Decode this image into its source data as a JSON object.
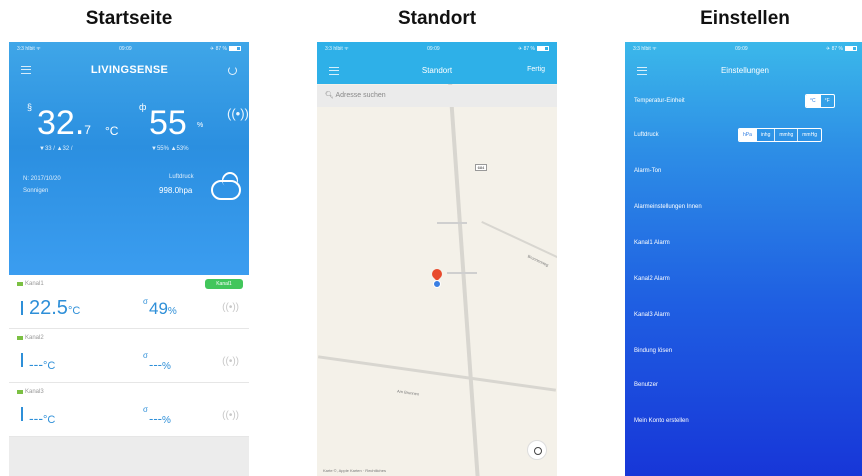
{
  "captions": [
    "Startseite",
    "Standort",
    "Einstellen"
  ],
  "home": {
    "status_left": "3:3 hIbit ᯤ",
    "status_time": "09:09",
    "status_right": "✈ 87 %",
    "logo": "LIVINGSENSE",
    "temp_symbol": "§",
    "temp_value": "32.",
    "temp_decimal": "7",
    "temp_unit": "°C",
    "temp_minmax": "▼33 / ▲32 /",
    "hum_symbol": "ф",
    "hum_value": "55",
    "hum_unit": "%",
    "hum_minmax": "▼55% ▲53%",
    "date_text": "N: 2017/10/20",
    "sub_text": "Sonnigen",
    "pressure_label": "Luftdruck",
    "pressure_value": "998.0hpa",
    "channels": [
      {
        "label": "Kanal1",
        "badge": "Kanal1",
        "temp": "22.5",
        "temp_unit": "°C",
        "hum": "49",
        "hum_unit": "%"
      },
      {
        "label": "Kanal2",
        "badge": "",
        "temp": "---",
        "temp_unit": "°C",
        "hum": "---",
        "hum_unit": "%"
      },
      {
        "label": "Kanal3",
        "badge": "",
        "temp": "---",
        "temp_unit": "°C",
        "hum": "---",
        "hum_unit": "%"
      }
    ]
  },
  "location": {
    "title": "Standort",
    "done_label": "Fertig",
    "search_placeholder": "Adresse suchen",
    "route_sign": "684",
    "road_label_1": "Brunnenweg",
    "road_label_2": "Am Brunnen",
    "map_credit": "Karte ©, Apple Karten · Rechtliches"
  },
  "settings": {
    "title": "Einstellungen",
    "rows": {
      "temp_unit": "Temperatur-Einheit",
      "pressure": "Luftdruck",
      "alarm_tone": "Alarm-Ton",
      "alarm_inside": "Alarmeinstellungen Innen",
      "ch1_alarm": "Kanal1 Alarm",
      "ch2_alarm": "Kanal2 Alarm",
      "ch3_alarm": "Kanal3 Alarm",
      "binding": "Bindung lösen",
      "user": "Benutzer",
      "create_account": "Mein Konto erstellen"
    },
    "temp_units": [
      "°C",
      "°F"
    ],
    "pressure_units": [
      "hPa",
      "inhg",
      "mmhg",
      "mmHg"
    ]
  }
}
